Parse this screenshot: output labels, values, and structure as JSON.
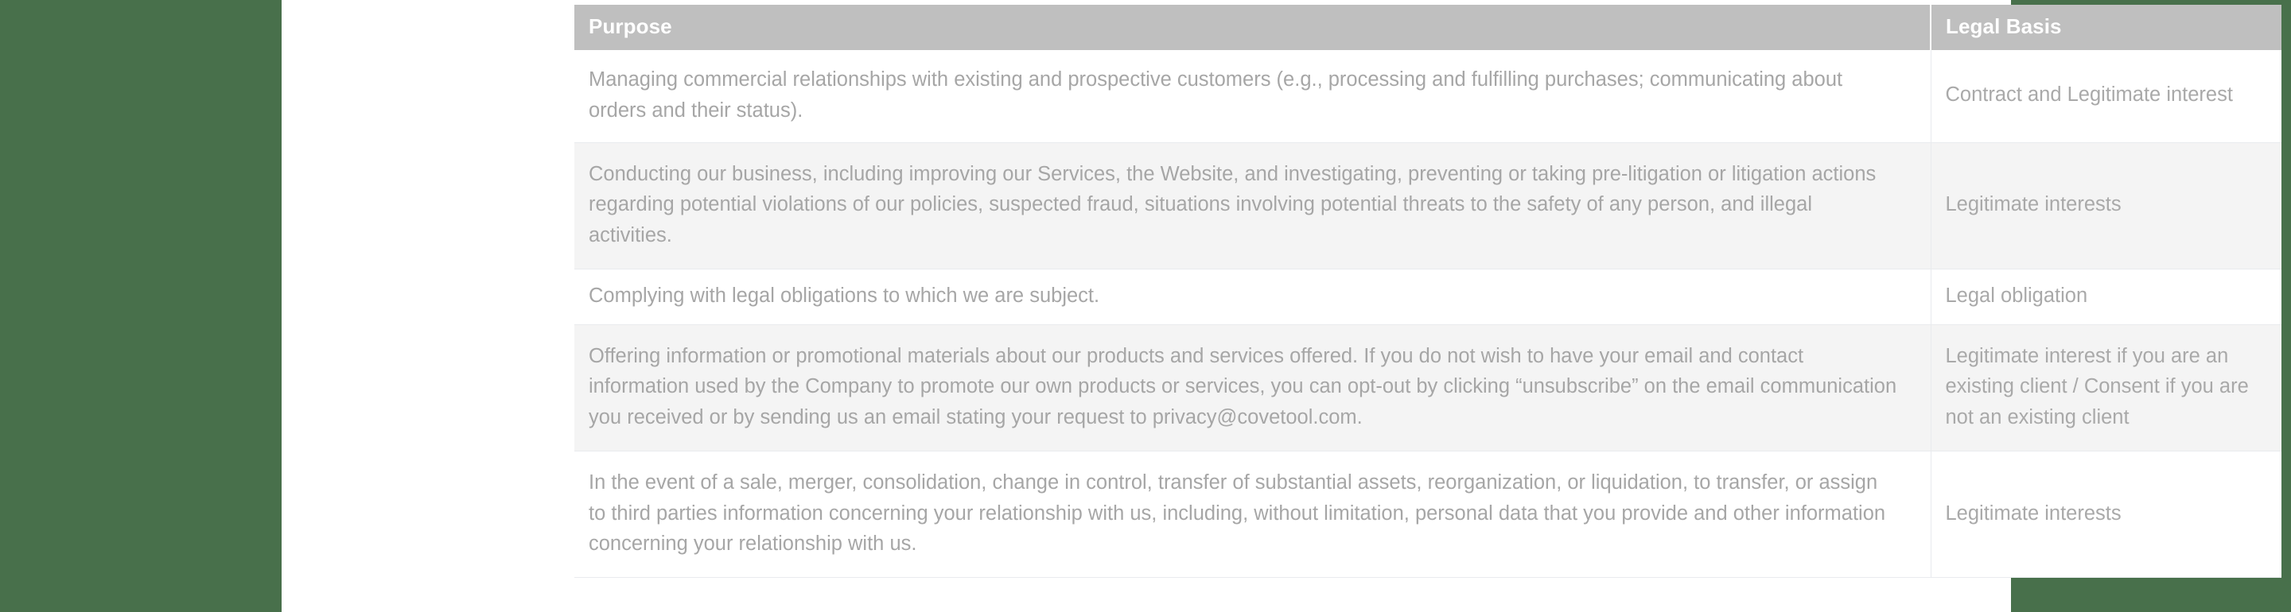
{
  "page": {
    "background_color": "#48704b",
    "content_background": "#ffffff",
    "header_background": "#bfbfbf",
    "header_text_color": "#ffffff",
    "body_text_color": "#a6a6a6",
    "shaded_row_color": "#f4f4f4",
    "row_border_color": "#e9ebee"
  },
  "table": {
    "columns": [
      {
        "key": "purpose",
        "label": "Purpose"
      },
      {
        "key": "legal_basis",
        "label": "Legal Basis"
      }
    ],
    "rows": [
      {
        "purpose": "Managing commercial relationships with existing and prospective customers (e.g., processing and fulfilling purchases; communicating about orders and their status).",
        "legal_basis": "Contract and Legitimate interest",
        "shaded": false
      },
      {
        "purpose": "Conducting our business, including improving our Services, the Website, and investigating, preventing or taking pre-litigation or litigation actions regarding potential violations of our policies, suspected fraud, situations involving potential threats to the safety of any person, and illegal activities.",
        "legal_basis": "Legitimate interests",
        "shaded": true
      },
      {
        "purpose": "Complying with legal obligations to which we are subject.",
        "legal_basis": "Legal obligation",
        "shaded": false
      },
      {
        "purpose": "Offering information or promotional materials about our products and services offered. If you do not wish to have your email and contact information used by the Company to promote our own products or services, you can opt-out by clicking “unsubscribe” on the email communication you received or by sending us an email stating your request to privacy@covetool.com.",
        "legal_basis": "Legitimate interest if you are an existing client / Consent if you are not an existing client",
        "shaded": true
      },
      {
        "purpose": "In the event of a sale, merger, consolidation, change in control, transfer of substantial assets, reorganization, or liquidation, to transfer, or assign to third parties information concerning your relationship with us, including, without limitation, personal data that you provide and other information concerning your relationship with us.",
        "legal_basis": "Legitimate interests",
        "shaded": false
      }
    ]
  }
}
